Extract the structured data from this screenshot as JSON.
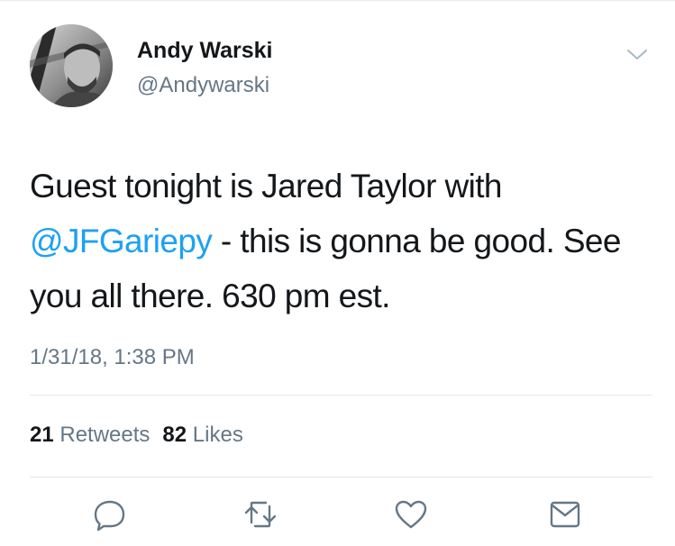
{
  "tweet": {
    "author": {
      "name": "Andy Warski",
      "handle": "@Andywarski"
    },
    "text": {
      "part1": "Guest tonight is Jared Taylor with",
      "mention": "@JFGariepy",
      "part2": " - this is gonna be good. See you all there. 630 pm est."
    },
    "timestamp": "1/31/18, 1:38 PM",
    "stats": {
      "retweets_count": "21",
      "retweets_label": "Retweets",
      "likes_count": "82",
      "likes_label": "Likes"
    },
    "actions": [
      "reply-icon",
      "retweet-icon",
      "like-icon",
      "share-icon"
    ]
  },
  "colors": {
    "accent": "#1da1f2",
    "text": "#14171a",
    "secondary": "#657786",
    "divider": "#e1e8ed"
  }
}
